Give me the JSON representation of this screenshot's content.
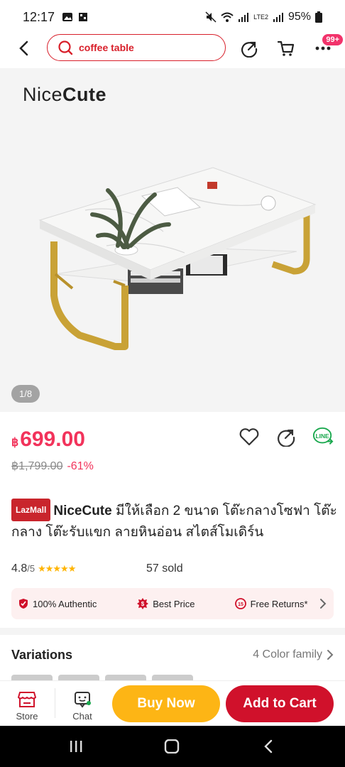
{
  "status_bar": {
    "time": "12:17",
    "battery": "95%",
    "net_label": "LTE2"
  },
  "header": {
    "search_query": "coffee table",
    "cart_badge": "99+"
  },
  "gallery": {
    "brand_logo_light": "Nice",
    "brand_logo_bold": "Cute",
    "counter": "1/8"
  },
  "price": {
    "currency": "฿",
    "current": "699.00",
    "original": "฿1,799.00",
    "discount": "-61%"
  },
  "product": {
    "mall_badge": "LazMall",
    "brand": "NiceCute",
    "title": "มีให้เลือก 2 ขนาด โต๊ะกลางโซฟา โต๊ะกลาง โต๊ะรับแขก ลายหินอ่อน สไตส์โมเดิร์น"
  },
  "rating": {
    "score": "4.8",
    "out_of": "/5",
    "stars": "★★★★★",
    "sold": "57 sold"
  },
  "guarantees": {
    "authentic": "100% Authentic",
    "best_price": "Best Price",
    "free_returns": "Free Returns*"
  },
  "variations": {
    "heading": "Variations",
    "summary": "4 Color family"
  },
  "bottom_bar": {
    "store": "Store",
    "chat": "Chat",
    "buy_now": "Buy Now",
    "add_to_cart": "Add to Cart"
  },
  "colors": {
    "brand_red": "#d81f2a",
    "price_pink": "#f2335b",
    "buy_now_yellow": "#fdb515",
    "add_to_cart_red": "#d0112b",
    "line_green": "#1aa84e"
  }
}
